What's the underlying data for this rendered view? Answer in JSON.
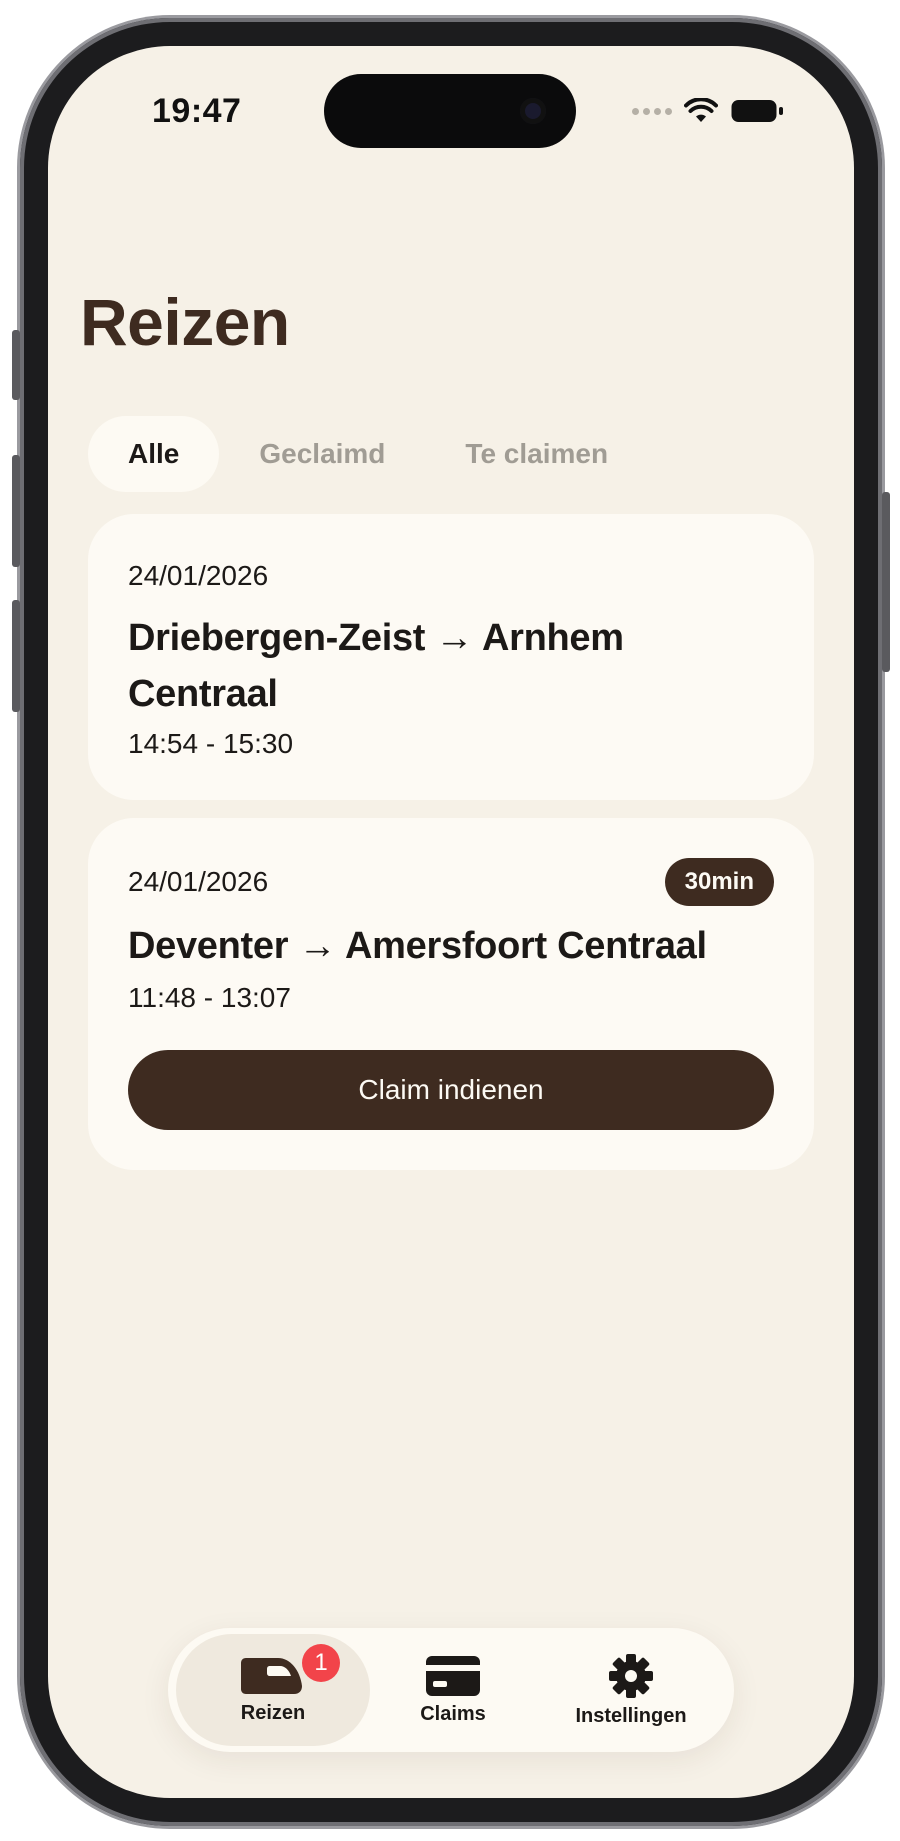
{
  "status_bar": {
    "time": "19:47"
  },
  "page": {
    "title": "Reizen"
  },
  "filter_tabs": [
    {
      "label": "Alle",
      "active": true
    },
    {
      "label": "Geclaimd",
      "active": false
    },
    {
      "label": "Te claimen",
      "active": false
    }
  ],
  "trips": [
    {
      "date": "24/01/2026",
      "route": "Driebergen-Zeist → Arnhem Centraal",
      "time": "14:54 - 15:30"
    },
    {
      "date": "24/01/2026",
      "route": "Deventer → Amersfoort Centraal",
      "time": "11:48 - 13:07",
      "delay": "30min",
      "action_label": "Claim indienen"
    }
  ],
  "tab_bar": {
    "items": [
      {
        "label": "Reizen",
        "icon": "train-icon",
        "active": true,
        "badge": "1"
      },
      {
        "label": "Claims",
        "icon": "card-icon",
        "active": false
      },
      {
        "label": "Instellingen",
        "icon": "gear-icon",
        "active": false
      }
    ]
  },
  "colors": {
    "background": "#f6f1e7",
    "card": "#fdfaf4",
    "accent_brown": "#3e2b20",
    "badge_red": "#f2444a",
    "inactive_text": "#a09c94"
  }
}
